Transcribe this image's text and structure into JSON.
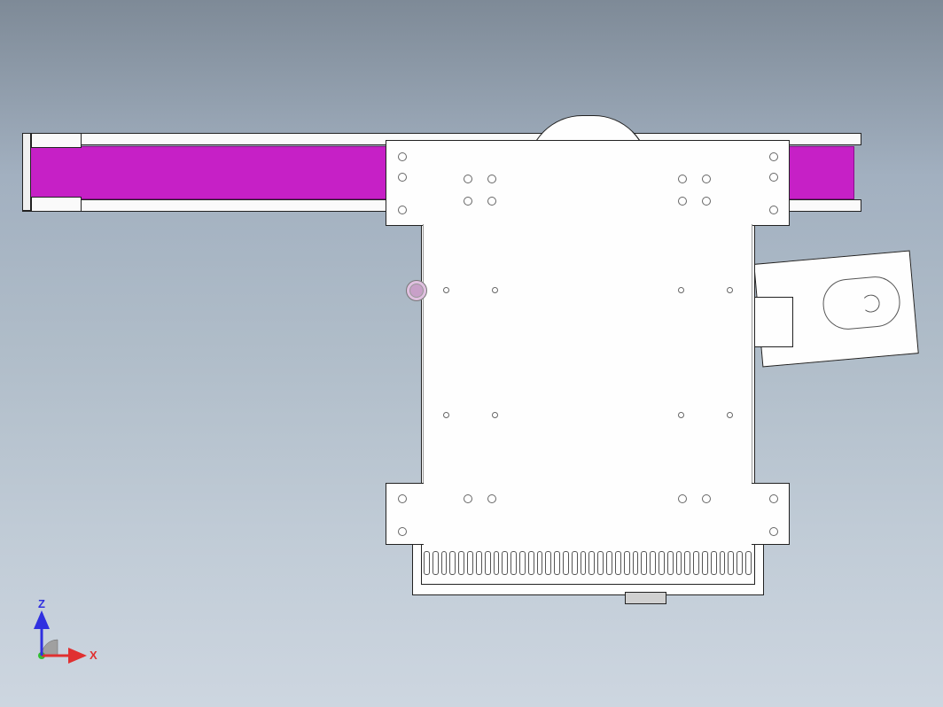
{
  "triad": {
    "x_label": "X",
    "z_label": "Z",
    "x_color": "#e03030",
    "z_color": "#3030e0",
    "y_color": "#30c030"
  },
  "model": {
    "beam_color": "#c620c6",
    "body_color": "#fefefe"
  }
}
